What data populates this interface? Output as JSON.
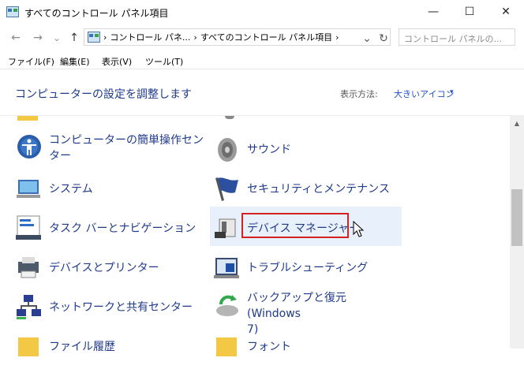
{
  "window": {
    "title": "すべてのコントロール パネル項目",
    "minimize": "—",
    "maximize": "☐",
    "close": "✕"
  },
  "nav": {
    "back": "←",
    "forward": "→",
    "recent": "⌄",
    "up": "↑",
    "refresh": "↻",
    "dropdown": "⌄"
  },
  "address": {
    "sep1": "›",
    "crumb1": "コントロール パネ...",
    "sep2": "›",
    "crumb2": "すべてのコントロール パネル項目",
    "sep3": "›"
  },
  "search": {
    "placeholder": "コントロール パネルの..."
  },
  "menu": {
    "file": "ファイル(F)",
    "edit": "編集(E)",
    "view": "表示(V)",
    "tools": "ツール(T)"
  },
  "header": {
    "title": "コンピューターの設定を調整します",
    "view_label": "表示方法:",
    "view_value": "大きいアイコン",
    "view_caret": "▾"
  },
  "items": {
    "ease_line1": "コンピューターの簡単操作セン",
    "ease_line2": "ター",
    "sound": "サウンド",
    "system": "システム",
    "security": "セキュリティとメンテナンス",
    "taskbar": "タスク バーとナビゲーション",
    "device_manager": "デバイス マネージャー",
    "devices_printers": "デバイスとプリンター",
    "troubleshooting": "トラブルシューティング",
    "network": "ネットワークと共有センター",
    "backup_line1": "バックアップと復元 (Windows",
    "backup_line2": "7)",
    "file_history": "ファイル履歴",
    "fonts": "フォント"
  },
  "scrollbar": {
    "up": "▲"
  },
  "colors": {
    "link": "#1e3a8a",
    "highlight": "#e8f1fb",
    "red_box": "#d32222"
  }
}
